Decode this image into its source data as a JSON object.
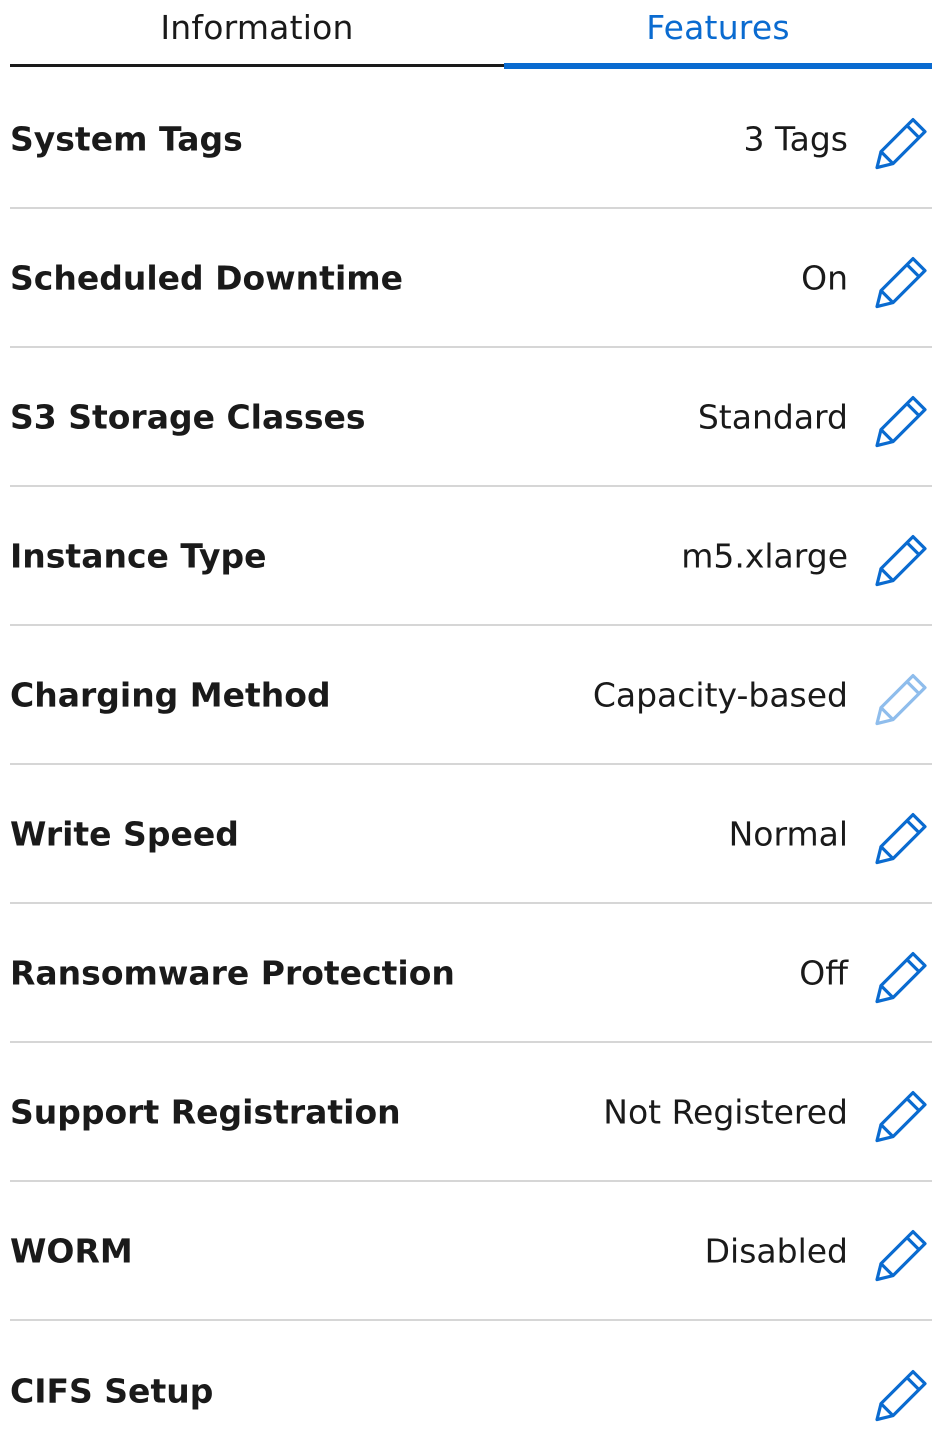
{
  "tabs": {
    "information": "Information",
    "features": "Features"
  },
  "rows": [
    {
      "label": "System Tags",
      "value": "3 Tags",
      "edit_enabled": true
    },
    {
      "label": "Scheduled Downtime",
      "value": "On",
      "edit_enabled": true
    },
    {
      "label": "S3 Storage Classes",
      "value": "Standard",
      "edit_enabled": true
    },
    {
      "label": "Instance Type",
      "value": "m5.xlarge",
      "edit_enabled": true
    },
    {
      "label": "Charging Method",
      "value": "Capacity-based",
      "edit_enabled": false
    },
    {
      "label": "Write Speed",
      "value": "Normal",
      "edit_enabled": true
    },
    {
      "label": "Ransomware Protection",
      "value": "Off",
      "edit_enabled": true
    },
    {
      "label": "Support Registration",
      "value": "Not Registered",
      "edit_enabled": true
    },
    {
      "label": "WORM",
      "value": "Disabled",
      "edit_enabled": true
    },
    {
      "label": "CIFS Setup",
      "value": "",
      "edit_enabled": true
    }
  ],
  "icons": {
    "edit": "pencil-icon"
  },
  "colors": {
    "accent": "#0a6bd0",
    "accent_disabled": "#8fbdec",
    "divider": "#d6d6d6",
    "text": "#1a1a1a"
  }
}
